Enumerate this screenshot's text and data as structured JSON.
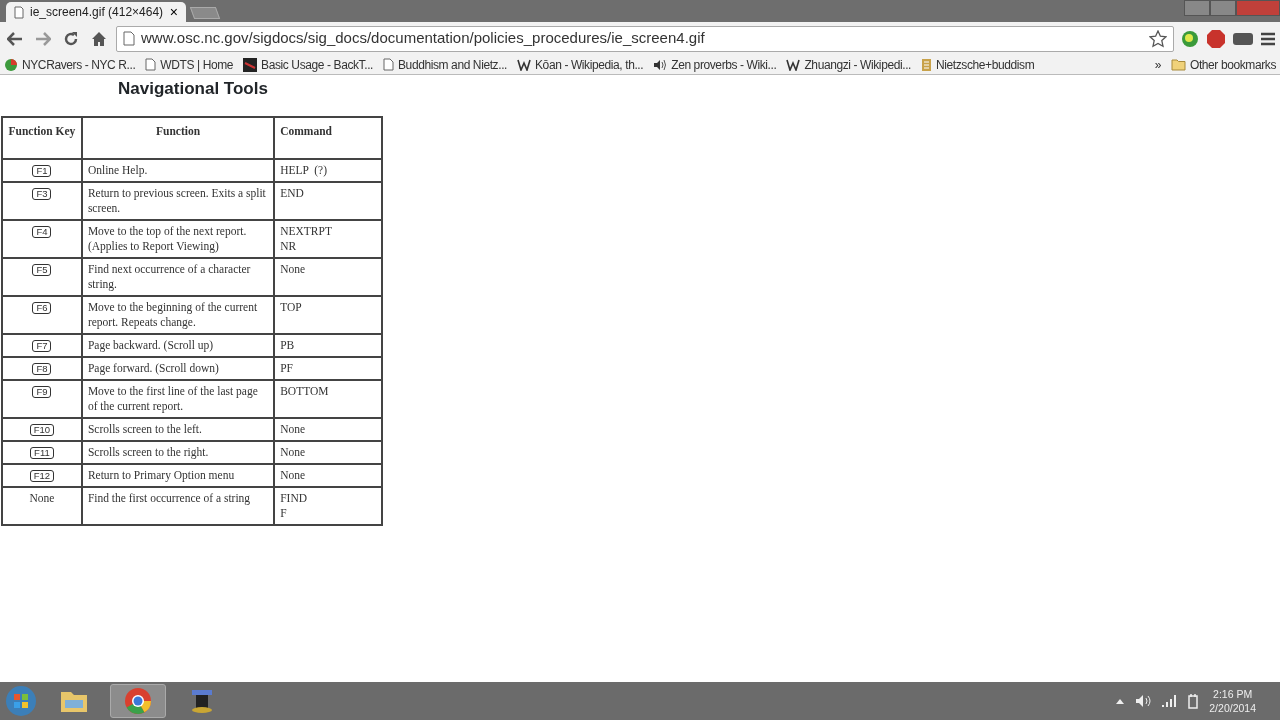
{
  "browser": {
    "tabs": [
      {
        "title": "ie_screen4.gif (412×464)",
        "selected": true,
        "close": "×"
      }
    ],
    "address": "www.osc.nc.gov/sigdocs/sig_docs/documentation/policies_procedures/ie_screen4.gif",
    "bookmarks": [
      {
        "label": "NYCRavers - NYC R..."
      },
      {
        "label": "WDTS | Home"
      },
      {
        "label": "Basic Usage - BackT..."
      },
      {
        "label": "Buddhism and Nietz..."
      },
      {
        "label": "Kōan - Wikipedia, th..."
      },
      {
        "label": "Zen proverbs - Wiki..."
      },
      {
        "label": "Zhuangzi - Wikipedi..."
      },
      {
        "label": "Nietzsche+buddism"
      }
    ],
    "more": "»",
    "other_bookmarks": "Other bookmarks"
  },
  "document": {
    "title": "Navigational Tools",
    "columns": [
      "Function Key",
      "Function",
      "Command"
    ],
    "rows": [
      {
        "key": "F1",
        "kind": "key",
        "function": "Online Help.",
        "command": [
          "HELP  (?)"
        ]
      },
      {
        "key": "F3",
        "kind": "key",
        "function": "Return to previous screen. Exits a split screen.",
        "command": [
          "END"
        ]
      },
      {
        "key": "F4",
        "kind": "key",
        "function": "Move to the top of the next report. (Applies to Report Viewing)",
        "command": [
          "NEXTRPT",
          "NR"
        ]
      },
      {
        "key": "F5",
        "kind": "key",
        "function": "Find next occurrence of a character string.",
        "command": [
          "None"
        ]
      },
      {
        "key": "F6",
        "kind": "key",
        "function": "Move to the beginning of the current report.  Repeats change.",
        "command": [
          "TOP"
        ]
      },
      {
        "key": "F7",
        "kind": "key",
        "function": "Page backward. (Scroll up)",
        "command": [
          "PB"
        ]
      },
      {
        "key": "F8",
        "kind": "key",
        "function": "Page forward. (Scroll down)",
        "command": [
          "PF"
        ]
      },
      {
        "key": "F9",
        "kind": "key",
        "function": "Move to the first line of the last page of the current report.",
        "command": [
          "BOTTOM"
        ]
      },
      {
        "key": "F10",
        "kind": "key",
        "function": "Scrolls screen to the left.",
        "command": [
          "None"
        ]
      },
      {
        "key": "F11",
        "kind": "key",
        "function": "Scrolls screen to the right.",
        "command": [
          "None"
        ]
      },
      {
        "key": "F12",
        "kind": "key",
        "function": "Return to Primary Option menu",
        "command": [
          "None"
        ]
      },
      {
        "key": "None",
        "kind": "text",
        "function": "Find the first occurrence of a string",
        "command": [
          "FIND",
          "F"
        ]
      }
    ]
  },
  "taskbar": {
    "time": "2:16 PM",
    "date": "2/20/2014"
  }
}
